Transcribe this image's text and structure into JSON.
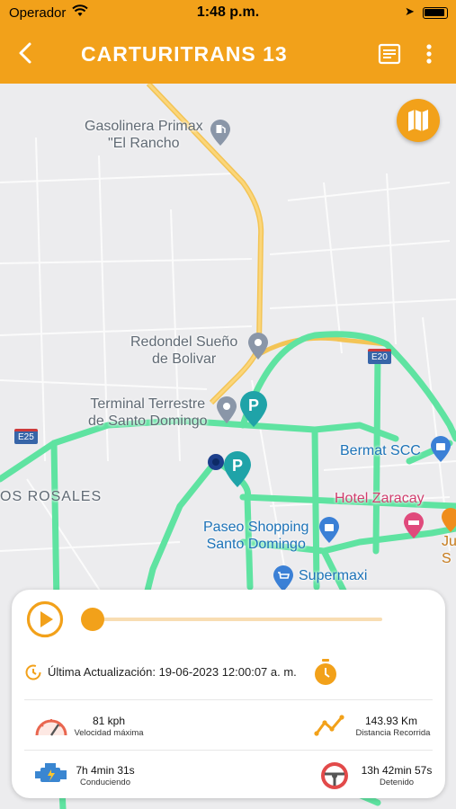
{
  "status_bar": {
    "carrier": "Operador",
    "time": "1:48 p.m."
  },
  "header": {
    "title": "CARTURITRANS  13"
  },
  "map": {
    "labels": {
      "gas_station": "Gasolinera Primax\n\"El Rancho",
      "redondel": "Redondel Sueño\nde Bolivar",
      "terminal": "Terminal Terrestre\nde Santo Domingo",
      "rosales": "OS ROSALES",
      "bermat": "Bermat SCC",
      "hotel": "Hotel Zaracay",
      "paseo": "Paseo Shopping\nSanto Domingo",
      "supermaxi": "Supermaxi",
      "ju": "Ju\nS",
      "e20": "E20",
      "e25": "E25"
    },
    "route_color": "#5fe3a1",
    "accent_color": "#f2a11a"
  },
  "panel": {
    "playback_progress": 0,
    "last_update_label": "Última Actualización:",
    "last_update_value": "19-06-2023 12:00:07 a. m.",
    "max_speed": {
      "value": "81 kph",
      "caption": "Velocidad máxima"
    },
    "distance": {
      "value": "143.93 Km",
      "caption": "Distancia Recorrida"
    },
    "driving": {
      "value": "7h 4min 31s",
      "caption": "Conduciendo"
    },
    "stopped": {
      "value": "13h 42min 57s",
      "caption": "Detenido"
    }
  }
}
